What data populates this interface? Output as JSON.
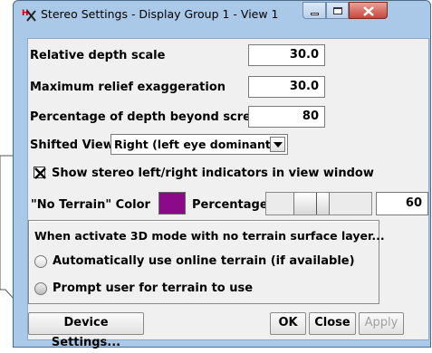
{
  "window": {
    "title": "Stereo Settings - Display Group 1 - View 1",
    "icons": [
      "stereo-app-icon",
      "minimize-icon",
      "maximize-icon",
      "close-icon"
    ],
    "close_button_color": "#c9463d"
  },
  "fields": {
    "relative_depth_scale": {
      "label": "Relative depth scale",
      "value": "30.0"
    },
    "max_relief": {
      "label": "Maximum relief exaggeration",
      "value": "30.0"
    },
    "depth_beyond": {
      "label": "Percentage of depth beyond screen",
      "value": "80"
    }
  },
  "shifted_view": {
    "label": "Shifted View",
    "selected": "Right (left eye dominant)"
  },
  "indicators": {
    "label": "Show stereo left/right indicators in view window",
    "checked": true
  },
  "no_terrain": {
    "color_label": "\"No Terrain\" Color",
    "swatch_color": "#8a0a8a",
    "percentage_label": "Percentage",
    "percentage_value": "60",
    "slider_fraction": 0.6
  },
  "terrain_group": {
    "heading": "When activate 3D mode with no terrain surface layer...",
    "options": [
      {
        "label": "Automatically use online terrain (if available)",
        "selected": false
      },
      {
        "label": "Prompt user for terrain to use",
        "selected": true
      }
    ]
  },
  "buttons": {
    "device": "Device Settings...",
    "ok": "OK",
    "close": "Close",
    "apply": "Apply"
  }
}
